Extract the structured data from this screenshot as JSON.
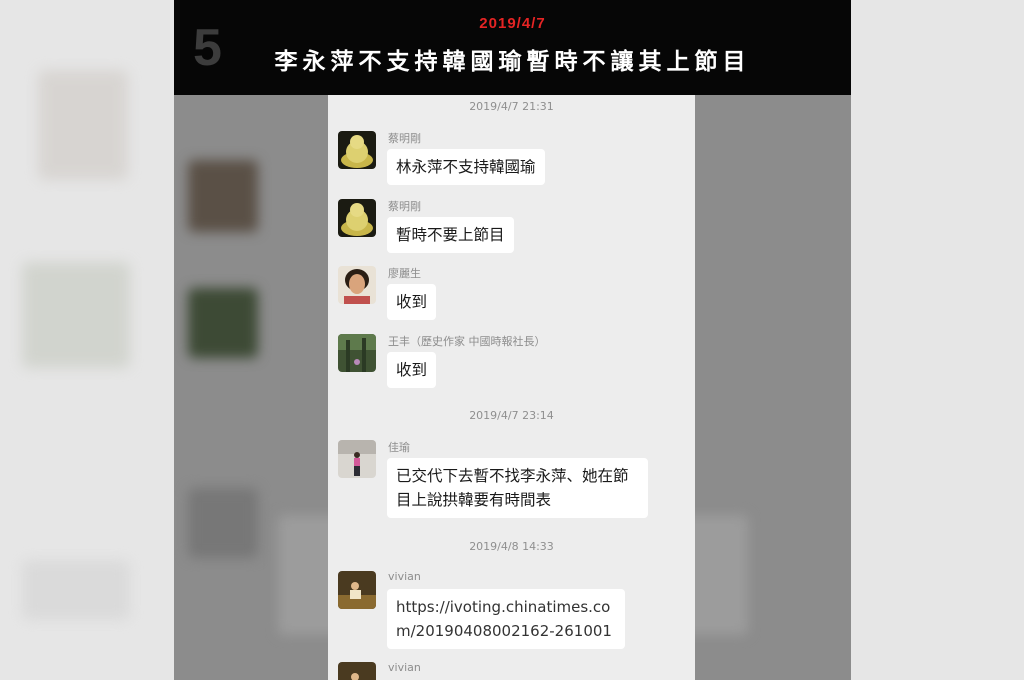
{
  "banner": {
    "number": "5",
    "date": "2019/4/7",
    "title": "李永萍不支持韓國瑜暫時不讓其上節目"
  },
  "chat": {
    "timestamps": [
      "2019/4/7 21:31",
      "2019/4/7 23:14",
      "2019/4/8 14:33"
    ],
    "messages": [
      {
        "sender": "蔡明剛",
        "text": "林永萍不支持韓國瑜",
        "avatar": "buddha-statue"
      },
      {
        "sender": "蔡明剛",
        "text": "暫時不要上節目",
        "avatar": "buddha-statue"
      },
      {
        "sender": "廖麗生",
        "text": "收到",
        "avatar": "woman-portrait"
      },
      {
        "sender": "王丰（歷史作家 中國時報社長）",
        "text": "收到",
        "avatar": "forest-scene"
      },
      {
        "sender": "佳瑜",
        "text": "已交代下去暫不找李永萍、她在節目上說拱韓要有時間表",
        "avatar": "woman-standing"
      },
      {
        "sender": "vivian",
        "text": "https://ivoting.chinatimes.com/20190408002162-261001",
        "avatar": "person-sitting"
      },
      {
        "sender": "vivian",
        "text": "",
        "avatar": "person-sitting"
      }
    ]
  }
}
